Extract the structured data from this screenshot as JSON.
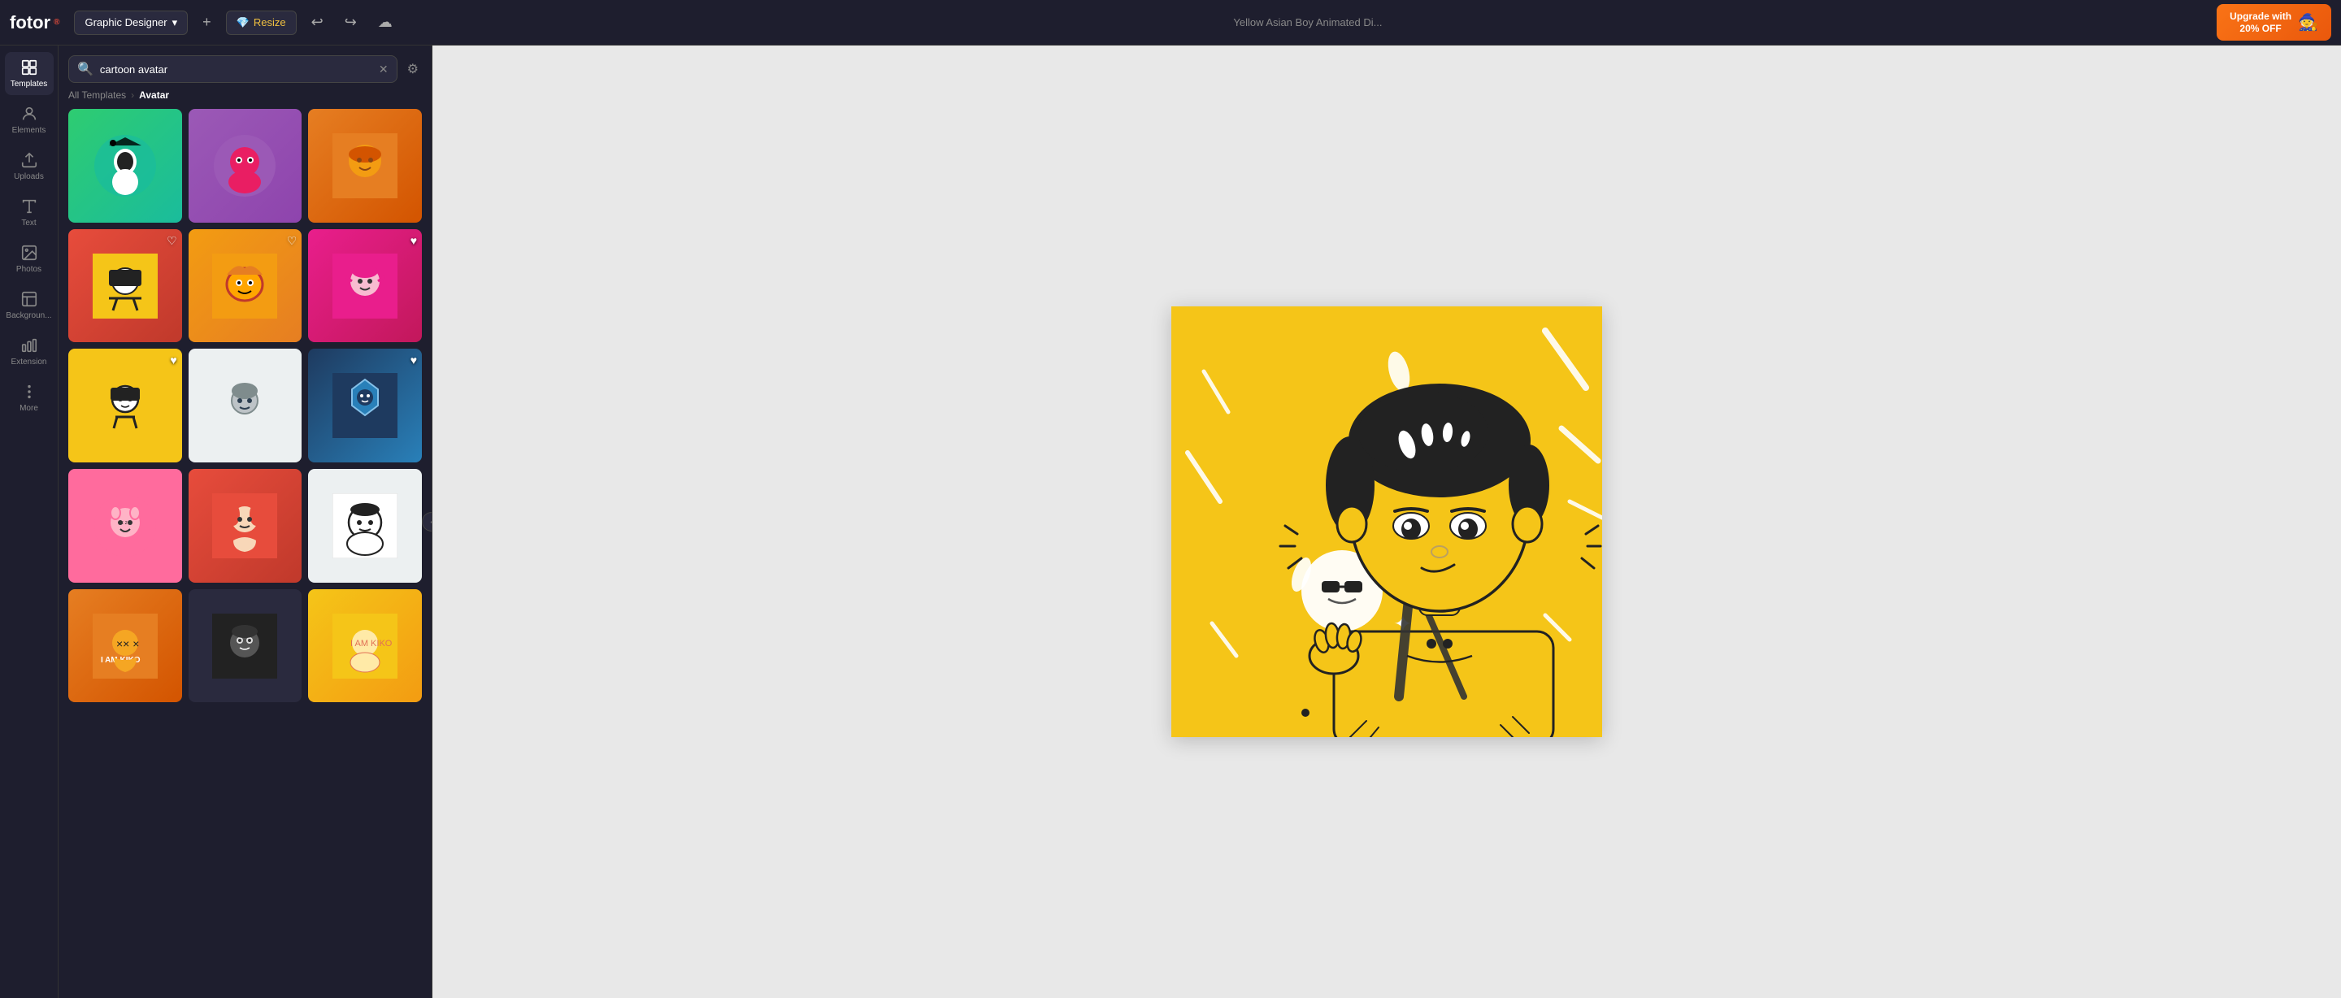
{
  "topbar": {
    "logo": "fotor",
    "logo_superscript": "®",
    "designer_label": "Graphic Designer",
    "plus_label": "+",
    "resize_label": "Resize",
    "undo_label": "↩",
    "redo_label": "↪",
    "upload_label": "⬆",
    "file_title": "Yellow Asian Boy Animated Di...",
    "upgrade_label": "Upgrade with\n20% OFF",
    "upgrade_icon": "🧙"
  },
  "sidebar": {
    "items": [
      {
        "id": "templates",
        "label": "Templates",
        "icon": "grid"
      },
      {
        "id": "elements",
        "label": "Elements",
        "icon": "elements"
      },
      {
        "id": "uploads",
        "label": "Uploads",
        "icon": "upload"
      },
      {
        "id": "text",
        "label": "Text",
        "icon": "text"
      },
      {
        "id": "photos",
        "label": "Photos",
        "icon": "photos"
      },
      {
        "id": "background",
        "label": "Backgroun...",
        "icon": "background"
      },
      {
        "id": "extension",
        "label": "Extension",
        "icon": "extension"
      },
      {
        "id": "more",
        "label": "More",
        "icon": "more"
      }
    ],
    "active": "templates"
  },
  "panel": {
    "search": {
      "placeholder": "cartoon avatar",
      "value": "cartoon avatar"
    },
    "breadcrumb": {
      "parent": "All Templates",
      "current": "Avatar"
    },
    "templates": [
      {
        "id": 1,
        "color": "card-1",
        "has_heart": false,
        "art": "👤"
      },
      {
        "id": 2,
        "color": "card-2",
        "has_heart": false,
        "art": "👾"
      },
      {
        "id": 3,
        "color": "card-3",
        "has_heart": false,
        "art": "🦊"
      },
      {
        "id": 4,
        "color": "card-4",
        "has_heart": true,
        "art": "🎨"
      },
      {
        "id": 5,
        "color": "card-5",
        "has_heart": false,
        "art": "🐯"
      },
      {
        "id": 6,
        "color": "card-6",
        "has_heart": true,
        "art": "💜"
      },
      {
        "id": 7,
        "color": "card-7",
        "has_heart": true,
        "art": "🌟"
      },
      {
        "id": 8,
        "color": "card-8",
        "has_heart": false,
        "art": "💠"
      },
      {
        "id": 9,
        "color": "card-9",
        "has_heart": true,
        "art": "🛡️"
      },
      {
        "id": 10,
        "color": "card-10",
        "has_heart": false,
        "art": "🐱"
      },
      {
        "id": 11,
        "color": "card-11",
        "has_heart": false,
        "art": "🔥"
      },
      {
        "id": 12,
        "color": "card-12",
        "has_heart": false,
        "art": "⚪"
      },
      {
        "id": 13,
        "color": "card-13",
        "has_heart": false,
        "art": "🎭"
      },
      {
        "id": 14,
        "color": "card-14",
        "has_heart": false,
        "art": "🌸"
      },
      {
        "id": 15,
        "color": "card-15",
        "has_heart": false,
        "art": "✨"
      }
    ]
  },
  "canvas": {
    "title": "Yellow Asian Boy Animated Di..."
  }
}
